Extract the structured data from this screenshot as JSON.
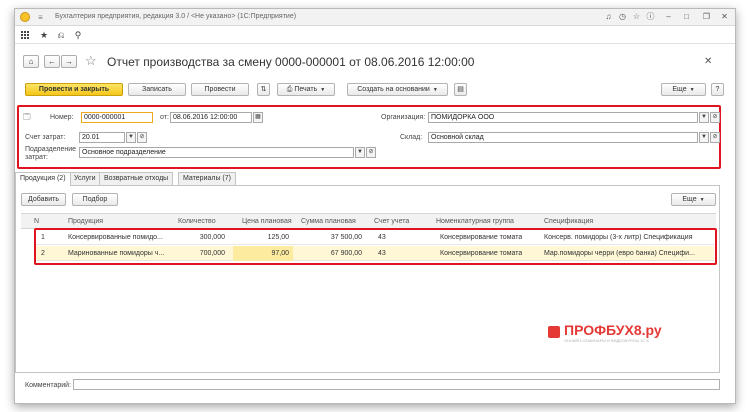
{
  "window": {
    "title": "Бухгалтерия предприятия, редакция 3.0 / <Не указано> (1С:Предприятие)"
  },
  "icons": {
    "logo": "1c-logo-icon",
    "grid": "grid-icon",
    "star": "star-icon",
    "history": "history-icon",
    "search": "search-icon",
    "home": "home-icon",
    "back": "arrow-left-icon",
    "forward": "arrow-right-icon"
  },
  "document": {
    "title": "Отчет производства за смену 0000-000001 от 08.06.2016 12:00:00"
  },
  "toolbar": {
    "post_close": "Провести и закрыть",
    "save": "Записать",
    "post": "Провести",
    "print": "Печать",
    "create_based": "Создать на основании",
    "more": "Еще"
  },
  "form": {
    "number_label": "Номер:",
    "number_value": "0000-000001",
    "date_label": "от:",
    "date_value": "08.06.2016 12:00:00",
    "org_label": "Организация:",
    "org_value": "ПОМИДОРКА ООО",
    "account_label": "Счет затрат:",
    "account_value": "20.01",
    "warehouse_label": "Склад:",
    "warehouse_value": "Основной склад",
    "division_label": "Подразделение затрат:",
    "division_value": "Основное подразделение"
  },
  "tabs": [
    {
      "label": "Продукция (2)"
    },
    {
      "label": "Услуги"
    },
    {
      "label": "Возвратные отходы"
    },
    {
      "label": "Материалы (7)"
    }
  ],
  "table_toolbar": {
    "add": "Добавить",
    "select": "Подбор",
    "more": "Еще"
  },
  "table": {
    "columns": [
      "N",
      "Продукция",
      "Количество",
      "Цена плановая",
      "Сумма плановая",
      "Счет учета",
      "Номенклатурная группа",
      "Спецификация"
    ],
    "rows": [
      [
        "1",
        "Консервированные помидо...",
        "300,000",
        "125,00",
        "37 500,00",
        "43",
        "Консервирование томата",
        "Консерв. помидоры (3-х литр) Спецификация"
      ],
      [
        "2",
        "Маринованные помидоры ч...",
        "700,000",
        "97,00",
        "67 900,00",
        "43",
        "Консервирование томата",
        "Мар.помидоры черри (евро банка) Специфи..."
      ]
    ]
  },
  "watermark": {
    "text": "ПРОФБУХ8.ру",
    "subtext": "ОНЛАЙН-СЕМИНАРЫ И ВИДЕОКУРСЫ 1С 8"
  },
  "comment": {
    "label": "Комментарий:",
    "value": ""
  },
  "colors": {
    "accent": "#f4c619",
    "highlight": "#e0141e",
    "selected_row": "#fff7d6"
  }
}
